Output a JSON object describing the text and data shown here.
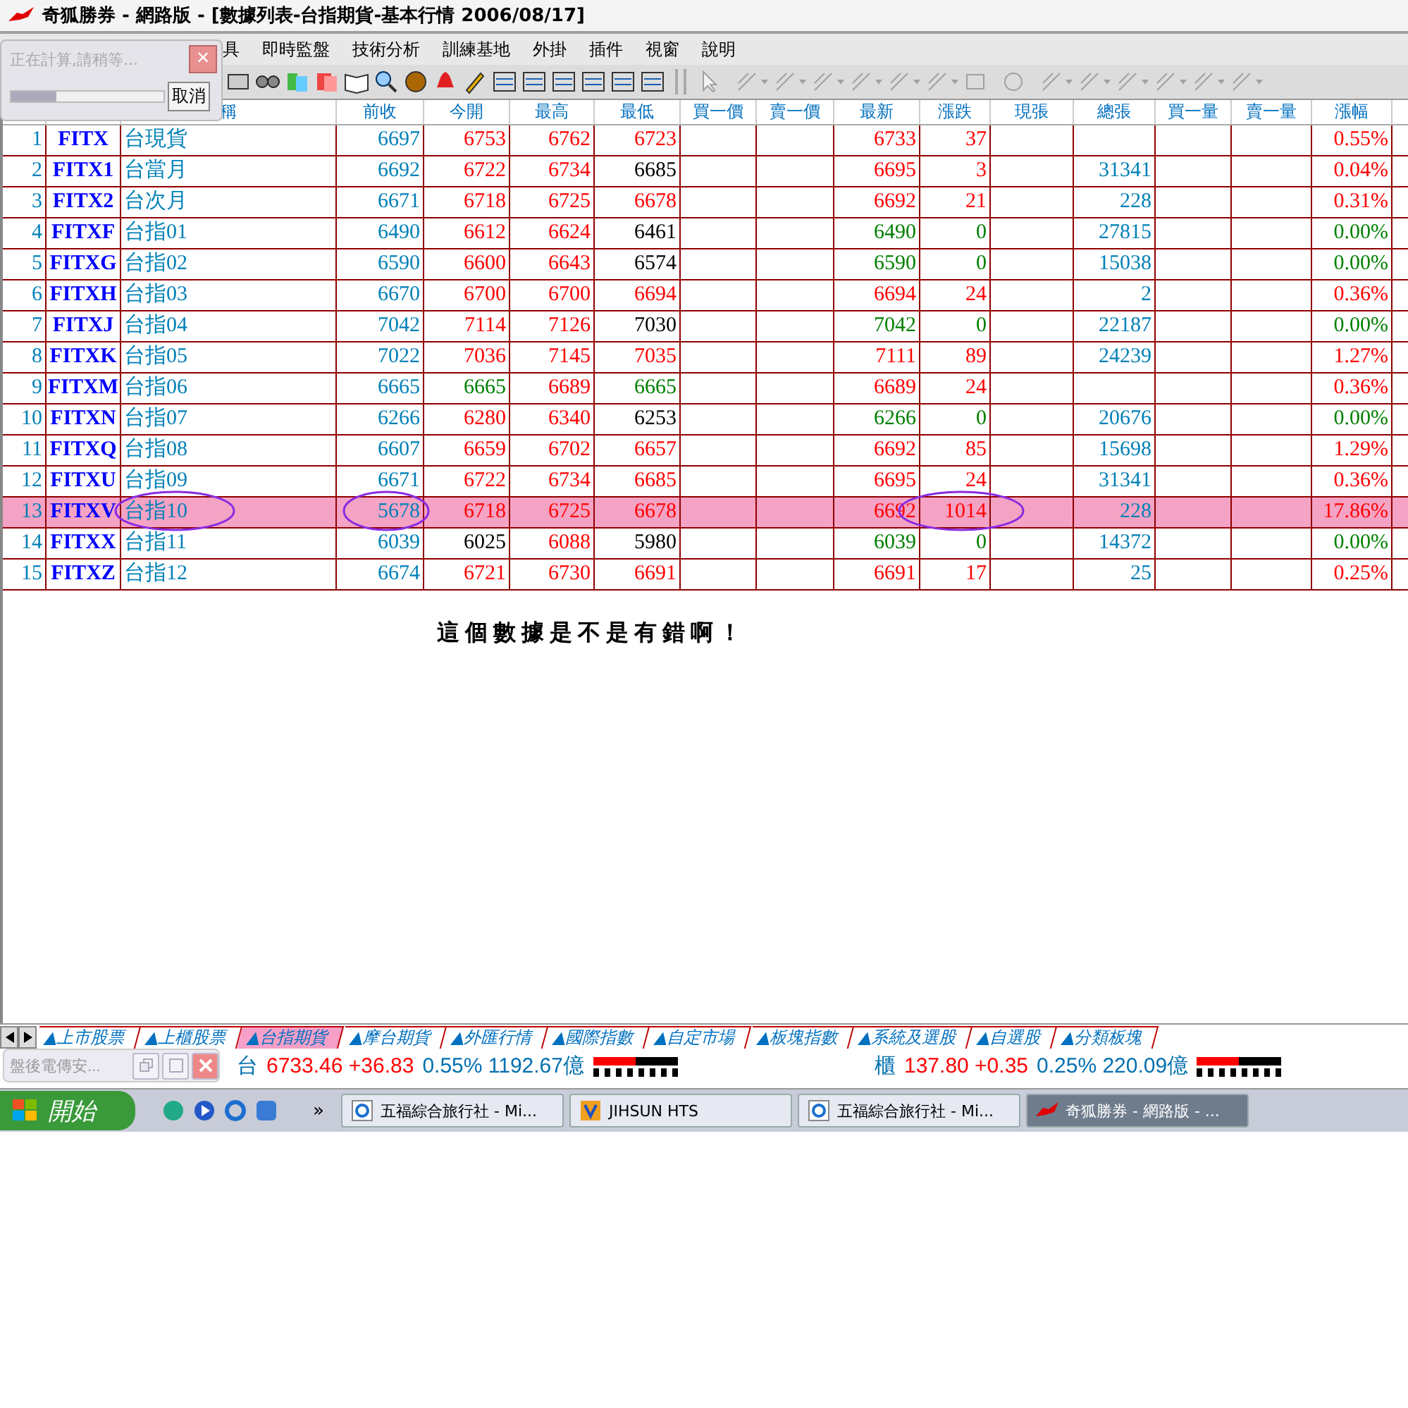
{
  "window": {
    "title": "奇狐勝券 - 網路版 - [數據列表-台指期貨-基本行情 2006/08/17]"
  },
  "menu": [
    "具",
    "即時監盤",
    "技術分析",
    "訓練基地",
    "外掛",
    "插件",
    "視窗",
    "說明"
  ],
  "progress_dialog": {
    "message": "正在計算,請稍等...",
    "close": "×",
    "level": 0.3,
    "cancel": "取消"
  },
  "table": {
    "columns": [
      "稱",
      "前收",
      "今開",
      "最高",
      "最低",
      "買一價",
      "賣一價",
      "最新",
      "漲跌",
      "現張",
      "總張",
      "買一量",
      "賣一量",
      "漲幅"
    ],
    "rows": [
      {
        "no": "1",
        "code": "FITX",
        "name": "台現貨",
        "prev": "6697",
        "open": "6753",
        "high": "6762",
        "low": "6723",
        "last": "6733",
        "change": "37",
        "pct": "0.55%",
        "selected": false
      },
      {
        "no": "2",
        "code": "FITX1",
        "name": "台當月",
        "prev": "6692",
        "open": "6722",
        "high": "6734",
        "low": "6685",
        "last": "6695",
        "change": "3",
        "total": "31341",
        "pct": "0.04%",
        "selected": false
      },
      {
        "no": "3",
        "code": "FITX2",
        "name": "台次月",
        "prev": "6671",
        "open": "6718",
        "high": "6725",
        "low": "6678",
        "last": "6692",
        "change": "21",
        "total": "228",
        "pct": "0.31%",
        "selected": false
      },
      {
        "no": "4",
        "code": "FITXF",
        "name": "台指01",
        "prev": "6490",
        "open": "6612",
        "high": "6624",
        "low": "6461",
        "last": "6490",
        "change": "0",
        "total": "27815",
        "pct": "0.00%",
        "selected": false
      },
      {
        "no": "5",
        "code": "FITXG",
        "name": "台指02",
        "prev": "6590",
        "open": "6600",
        "high": "6643",
        "low": "6574",
        "last": "6590",
        "change": "0",
        "total": "15038",
        "pct": "0.00%",
        "selected": false
      },
      {
        "no": "6",
        "code": "FITXH",
        "name": "台指03",
        "prev": "6670",
        "open": "6700",
        "high": "6700",
        "low": "6694",
        "last": "6694",
        "change": "24",
        "total": "2",
        "pct": "0.36%",
        "selected": false
      },
      {
        "no": "7",
        "code": "FITXJ",
        "name": "台指04",
        "prev": "7042",
        "open": "7114",
        "high": "7126",
        "low": "7030",
        "last": "7042",
        "change": "0",
        "total": "22187",
        "pct": "0.00%",
        "selected": false
      },
      {
        "no": "8",
        "code": "FITXK",
        "name": "台指05",
        "prev": "7022",
        "open": "7036",
        "high": "7145",
        "low": "7035",
        "last": "7111",
        "change": "89",
        "total": "24239",
        "pct": "1.27%",
        "selected": false
      },
      {
        "no": "9",
        "code": "FITXM",
        "name": "台指06",
        "prev": "6665",
        "open": "6665",
        "high": "6689",
        "low": "6665",
        "last": "6689",
        "change": "24",
        "pct": "0.36%",
        "selected": false
      },
      {
        "no": "10",
        "code": "FITXN",
        "name": "台指07",
        "prev": "6266",
        "open": "6280",
        "high": "6340",
        "low": "6253",
        "last": "6266",
        "change": "0",
        "total": "20676",
        "pct": "0.00%",
        "selected": false
      },
      {
        "no": "11",
        "code": "FITXQ",
        "name": "台指08",
        "prev": "6607",
        "open": "6659",
        "high": "6702",
        "low": "6657",
        "last": "6692",
        "change": "85",
        "total": "15698",
        "pct": "1.29%",
        "selected": false
      },
      {
        "no": "12",
        "code": "FITXU",
        "name": "台指09",
        "prev": "6671",
        "open": "6722",
        "high": "6734",
        "low": "6685",
        "last": "6695",
        "change": "24",
        "total": "31341",
        "pct": "0.36%",
        "selected": false
      },
      {
        "no": "13",
        "code": "FITXV",
        "name": "台指10",
        "prev": "5678",
        "open": "6718",
        "high": "6725",
        "low": "6678",
        "last": "6692",
        "change": "1014",
        "total": "228",
        "pct": "17.86%",
        "selected": true
      },
      {
        "no": "14",
        "code": "FITXX",
        "name": "台指11",
        "prev": "6039",
        "open": "6025",
        "high": "6088",
        "low": "5980",
        "last": "6039",
        "change": "0",
        "total": "14372",
        "pct": "0.00%",
        "selected": false
      },
      {
        "no": "15",
        "code": "FITXZ",
        "name": "台指12",
        "prev": "6674",
        "open": "6721",
        "high": "6730",
        "low": "6691",
        "last": "6691",
        "change": "17",
        "total": "25",
        "pct": "0.25%",
        "selected": false
      }
    ]
  },
  "note": "這個數據是不是有錯啊！",
  "tabs": [
    {
      "label": "▲上市股票",
      "selected": false
    },
    {
      "label": "▲上櫃股票",
      "selected": false
    },
    {
      "label": "▲台指期貨",
      "selected": true
    },
    {
      "label": "▲摩台期貨",
      "selected": false
    },
    {
      "label": "▲外匯行情",
      "selected": false
    },
    {
      "label": "▲國際指數",
      "selected": false
    },
    {
      "label": "▲自定市場",
      "selected": false
    },
    {
      "label": "▲板塊指數",
      "selected": false
    },
    {
      "label": "▲系統及選股",
      "selected": false
    },
    {
      "label": "▲自選股",
      "selected": false
    },
    {
      "label": "▲分類板塊",
      "selected": false
    }
  ],
  "mini_window": {
    "title": "盤後電傳安..."
  },
  "indices": [
    {
      "market": "台",
      "price": "6733.46 +36.83",
      "stats": "0.55% 1192.67億",
      "level": 0.5
    },
    {
      "market": "櫃",
      "price": "137.80 +0.35",
      "stats": "0.25% 220.09億",
      "level": 0.5
    }
  ],
  "taskbar": {
    "start": "開始",
    "chevron": "»",
    "tasks": [
      {
        "label": "五福綜合旅行社 - Mi...",
        "kind": "browser",
        "selected": false
      },
      {
        "label": "JIHSUN HTS",
        "kind": "app",
        "selected": false
      },
      {
        "label": "五福綜合旅行社 - Mi...",
        "kind": "browser",
        "selected": false
      },
      {
        "label": "奇狐勝券 - 網路版 - ...",
        "kind": "fox",
        "selected": true
      }
    ]
  }
}
